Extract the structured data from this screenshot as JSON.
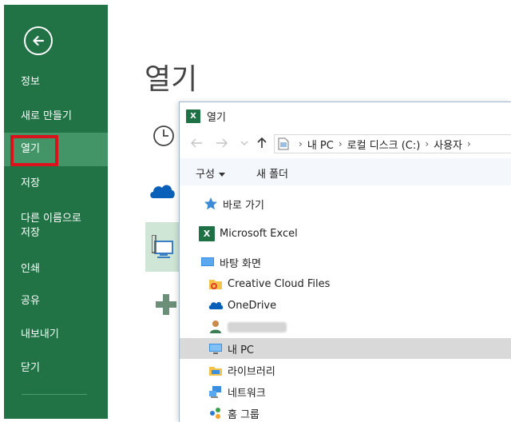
{
  "sidebar": {
    "items": [
      {
        "label": "정보"
      },
      {
        "label": "새로 만들기"
      },
      {
        "label": "열기",
        "active": true
      },
      {
        "label": "저장"
      },
      {
        "label": "다른 이름으로\n저장"
      },
      {
        "label": "인쇄"
      },
      {
        "label": "공유"
      },
      {
        "label": "내보내기"
      },
      {
        "label": "닫기"
      }
    ],
    "accent_color": "#217346",
    "highlight_color": "#d9121b"
  },
  "main": {
    "title": "열기"
  },
  "dialog": {
    "title": "열기",
    "app_badge": "X",
    "address": {
      "crumbs": [
        "내 PC",
        "로컬 디스크 (C:)",
        "사용자"
      ]
    },
    "toolbar": {
      "organize_label": "구성",
      "new_folder_label": "새 폴더"
    },
    "tree": [
      {
        "label": "바로 가기",
        "icon": "star-icon"
      },
      {
        "label": "Microsoft Excel",
        "icon": "excel-icon"
      },
      {
        "label": "바탕 화면",
        "icon": "desktop-icon"
      },
      {
        "label": "Creative Cloud Files",
        "icon": "creative-cloud-folder-icon"
      },
      {
        "label": "OneDrive",
        "icon": "onedrive-icon"
      },
      {
        "label": "",
        "icon": "user-icon"
      },
      {
        "label": "내 PC",
        "icon": "computer-icon",
        "selected": true
      },
      {
        "label": "라이브러리",
        "icon": "library-icon"
      },
      {
        "label": "네트워크",
        "icon": "network-icon"
      },
      {
        "label": "홈 그룹",
        "icon": "homegroup-icon"
      }
    ]
  }
}
